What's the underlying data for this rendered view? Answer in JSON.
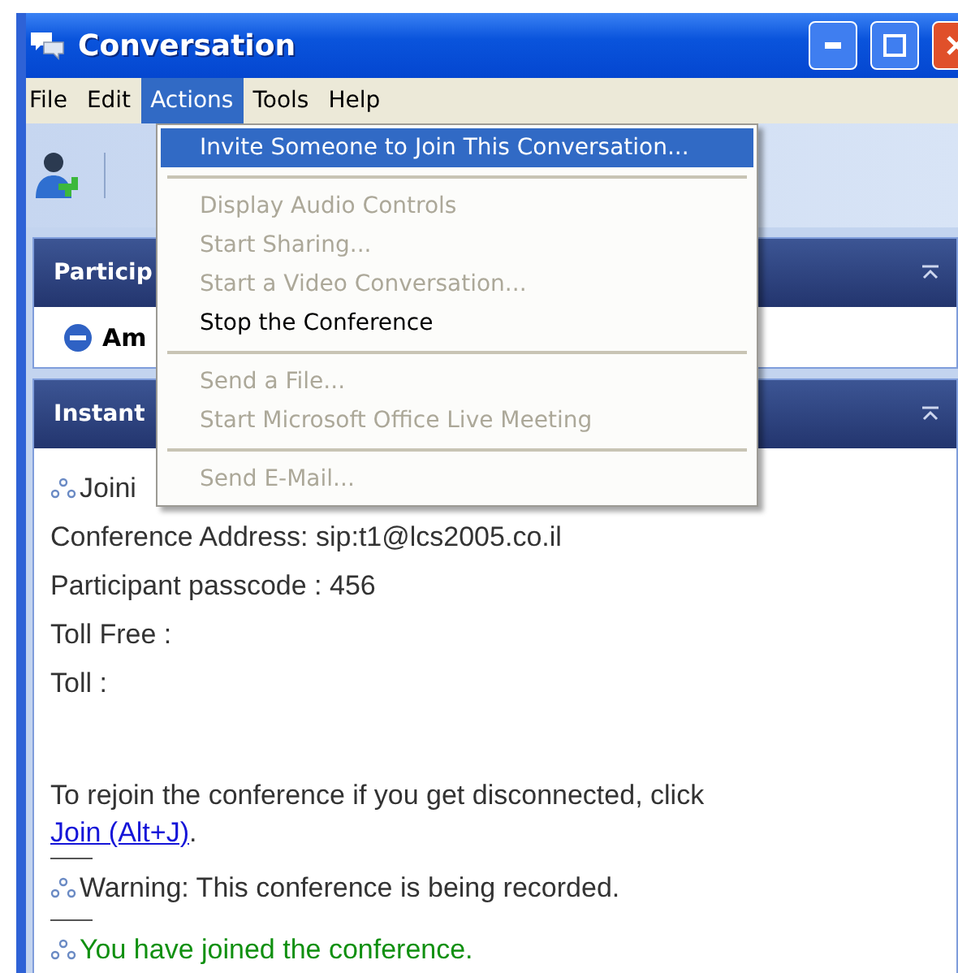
{
  "window": {
    "title": "Conversation"
  },
  "menu_bar": [
    {
      "label": "File",
      "selected": false
    },
    {
      "label": "Edit",
      "selected": false
    },
    {
      "label": "Actions",
      "selected": true
    },
    {
      "label": "Tools",
      "selected": false
    },
    {
      "label": "Help",
      "selected": false
    }
  ],
  "dropdown": [
    {
      "kind": "item",
      "label": "Invite Someone to Join This Conversation...",
      "disabled": false,
      "selected": true
    },
    {
      "kind": "separator"
    },
    {
      "kind": "item",
      "label": "Display Audio Controls",
      "disabled": true,
      "selected": false
    },
    {
      "kind": "item",
      "label": "Start Sharing...",
      "disabled": true,
      "selected": false
    },
    {
      "kind": "item",
      "label": "Start a Video Conversation...",
      "disabled": true,
      "selected": false
    },
    {
      "kind": "item",
      "label": "Stop the Conference",
      "disabled": false,
      "selected": false
    },
    {
      "kind": "separator"
    },
    {
      "kind": "item",
      "label": "Send a File...",
      "disabled": true,
      "selected": false
    },
    {
      "kind": "item",
      "label": "Start Microsoft Office Live Meeting",
      "disabled": true,
      "selected": false
    },
    {
      "kind": "separator"
    },
    {
      "kind": "item",
      "label": "Send E-Mail...",
      "disabled": true,
      "selected": false
    }
  ],
  "participants_panel": {
    "title": "Particip",
    "participants": [
      {
        "name": "Am"
      }
    ]
  },
  "instant_panel": {
    "title": "Instant"
  },
  "messages": [
    {
      "kind": "system",
      "text": "Joini",
      "color": "#333333"
    },
    {
      "kind": "line",
      "text": "Conference Address: sip:t1@lcs2005.co.il"
    },
    {
      "kind": "line",
      "text": "Participant passcode : 456"
    },
    {
      "kind": "line",
      "text": "Toll Free :"
    },
    {
      "kind": "line",
      "text": "Toll :"
    },
    {
      "kind": "blank"
    },
    {
      "kind": "link_line",
      "text": "To rejoin the conference if you get disconnected, click ",
      "link": "Join (Alt+J)",
      "after": "."
    },
    {
      "kind": "rule"
    },
    {
      "kind": "system",
      "text": "Warning: This conference is being recorded.",
      "color": "#333333"
    },
    {
      "kind": "rule"
    },
    {
      "kind": "system",
      "text": "You have joined the conference.",
      "color": "#109010"
    }
  ]
}
